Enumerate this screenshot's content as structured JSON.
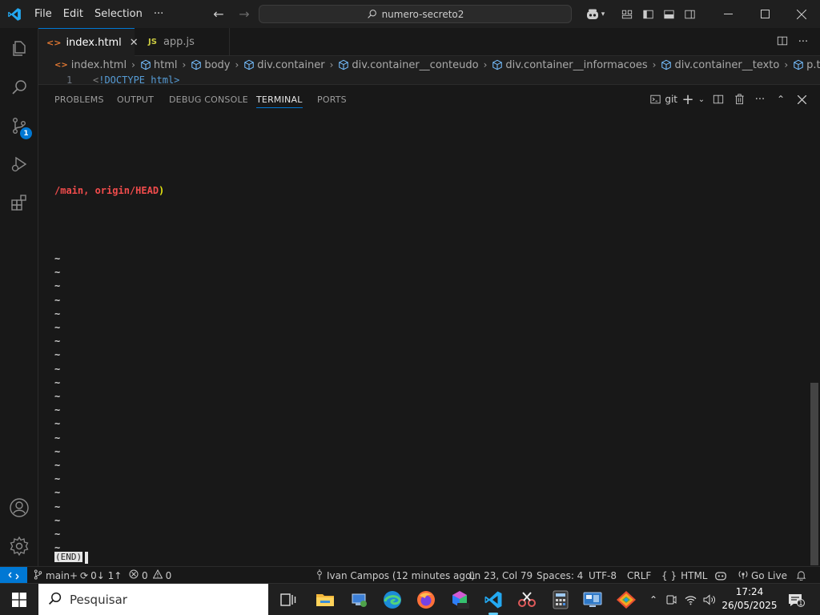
{
  "titlebar": {
    "menu": [
      "File",
      "Edit",
      "Selection",
      "···"
    ],
    "search_text": "numero-secreto2"
  },
  "tabs": [
    {
      "label": "index.html",
      "icon": "html-file-icon",
      "active": true
    },
    {
      "label": "app.js",
      "icon": "js-file-icon",
      "active": false
    }
  ],
  "file_icons": {
    "html": "<>",
    "js": "JS"
  },
  "breadcrumbs": [
    "index.html",
    "html",
    "body",
    "div.container",
    "div.container__conteudo",
    "div.container__informacoes",
    "div.container__texto",
    "p.texto__paragrafo"
  ],
  "editor_peek": {
    "line_number": "1",
    "code_lt": "<",
    "code_rest": "!DOCTYPE html>"
  },
  "activity": {
    "scm_badge": "1"
  },
  "panel": {
    "tabs": [
      "PROBLEMS",
      "OUTPUT",
      "DEBUG CONSOLE",
      "TERMINAL",
      "PORTS"
    ],
    "active_tab": "TERMINAL",
    "terminal_name": "git"
  },
  "terminal": {
    "ref_line_prefix": "/main, origin/HEAD",
    "ref_line_suffix": ")",
    "tilde": "~",
    "tilde_count": 22,
    "end_marker": "(END)"
  },
  "statusbar": {
    "branch": "main+",
    "sync": "0↓ 1↑",
    "errors": "0",
    "warnings": "0",
    "blame": "Ivan Campos (12 minutes ago)",
    "position": "Ln 23, Col 79",
    "spaces": "Spaces: 4",
    "encoding": "UTF-8",
    "eol": "CRLF",
    "braces": "{ }",
    "language": "HTML",
    "golive": "Go Live"
  },
  "taskbar": {
    "search_placeholder": "Pesquisar",
    "time": "17:24",
    "date": "26/05/2025",
    "notif_count": "1"
  },
  "colors": {
    "accent": "#0078d4",
    "terminal_red": "#f14c4c",
    "terminal_yellow": "#e5e510"
  }
}
